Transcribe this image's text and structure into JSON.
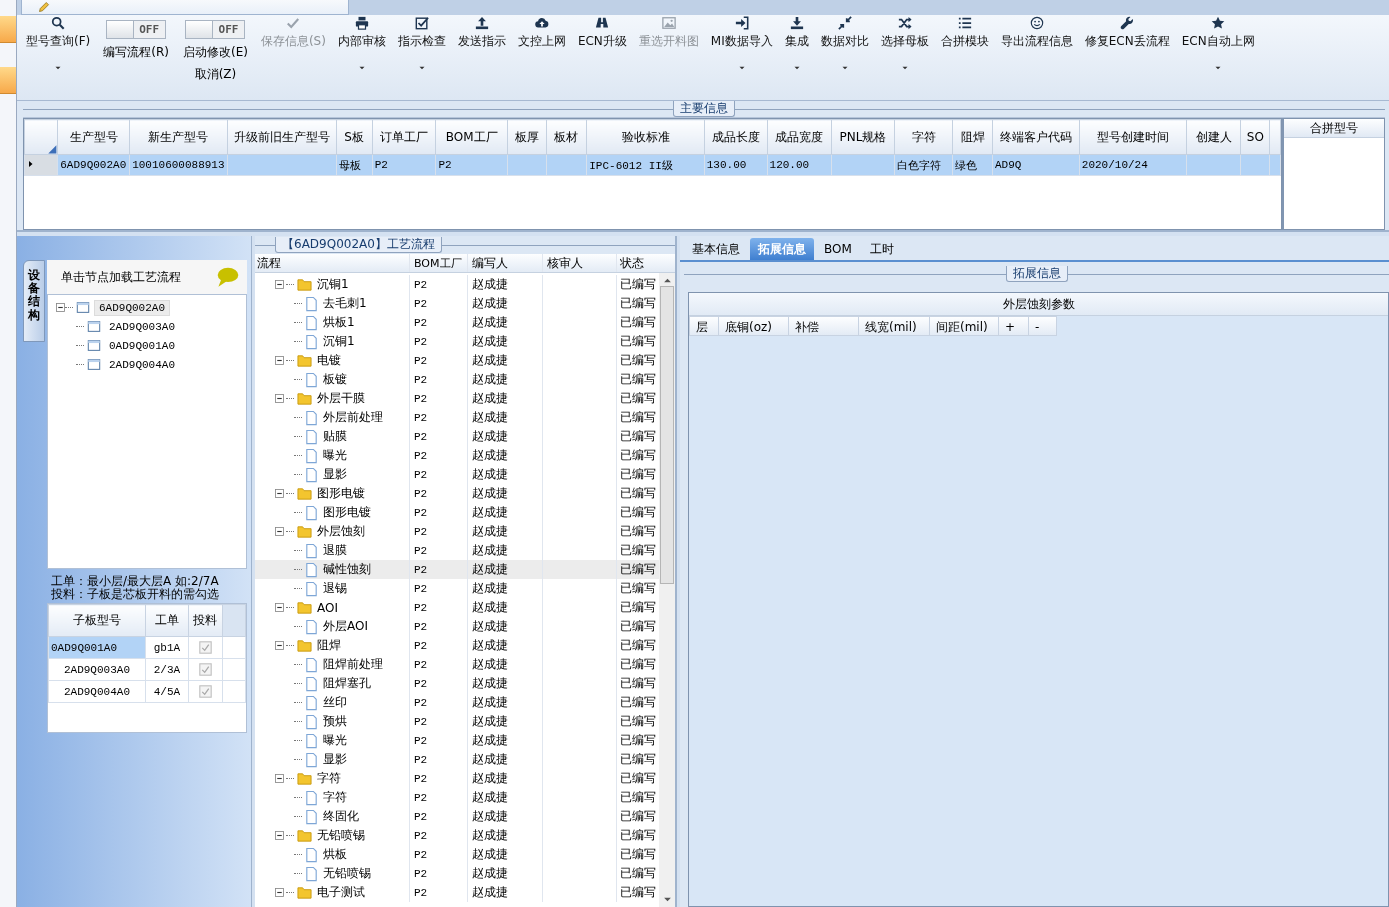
{
  "toolbar": [
    {
      "kind": "button",
      "label": "型号查询(F)",
      "disabled": false,
      "dropdown": true
    },
    {
      "kind": "toggle",
      "state_text": "OFF",
      "on": false,
      "label": "编写流程(R)"
    },
    {
      "kind": "toggle",
      "state_text": "OFF",
      "on": false,
      "label": "启动修改(E)",
      "label_2": "取消(Z)"
    },
    {
      "kind": "button",
      "label": "保存信息(S)",
      "disabled": true,
      "dropdown": false
    },
    {
      "kind": "button",
      "label": "内部审核",
      "disabled": false,
      "dropdown": true
    },
    {
      "kind": "button",
      "label": "指示检查",
      "disabled": false,
      "dropdown": true
    },
    {
      "kind": "button",
      "label": "发送指示",
      "disabled": false,
      "dropdown": false
    },
    {
      "kind": "button",
      "label": "文控上网",
      "disabled": false,
      "dropdown": false
    },
    {
      "kind": "button",
      "label": "ECN升级",
      "disabled": false,
      "dropdown": false
    },
    {
      "kind": "button",
      "label": "重选开料图",
      "disabled": true,
      "dropdown": false
    },
    {
      "kind": "button",
      "label": "MI数据导入",
      "disabled": false,
      "dropdown": true
    },
    {
      "kind": "button",
      "label": "集成",
      "disabled": false,
      "dropdown": true
    },
    {
      "kind": "button",
      "label": "数据对比",
      "disabled": false,
      "dropdown": true
    },
    {
      "kind": "button",
      "label": "选择母板",
      "disabled": false,
      "dropdown": true
    },
    {
      "kind": "button",
      "label": "合拼模块",
      "disabled": false,
      "dropdown": false
    },
    {
      "kind": "button",
      "label": "导出流程信息",
      "disabled": false,
      "dropdown": false
    },
    {
      "kind": "button",
      "label": "修复ECN丢流程",
      "disabled": false,
      "dropdown": false
    },
    {
      "kind": "button",
      "label": "ECN自动上网",
      "disabled": false,
      "dropdown": true
    }
  ],
  "main_info": {
    "legend": "主要信息",
    "columns": [
      "生产型号",
      "新生产型号",
      "升级前旧生产型号",
      "S板",
      "订单工厂",
      "BOM工厂",
      "板厚",
      "板材",
      "验收标准",
      "成品长度",
      "成品宽度",
      "PNL规格",
      "字符",
      "阻焊",
      "终端客户代码",
      "型号创建时间",
      "创建人",
      "SO"
    ],
    "rows": [
      {
        "selected": true,
        "cells": [
          "6AD9Q002A0",
          "10010600088913",
          "",
          "母板",
          "P2",
          "P2",
          "",
          "",
          "IPC-6012 II级",
          "130.00",
          "120.00",
          "",
          "白色字符",
          "绿色",
          "AD9Q",
          "2020/10/24",
          "",
          ""
        ]
      }
    ],
    "side_panel": {
      "title": "合拼型号"
    }
  },
  "board_panel": {
    "tab": "设备结构",
    "hint": "单击节点加载工艺流程",
    "nodes": [
      {
        "name": "6AD9Q002A0",
        "selected": true,
        "expanded": true,
        "children": [
          {
            "name": "2AD9Q003A0",
            "selected": false
          },
          {
            "name": "0AD9Q001A0",
            "selected": false
          },
          {
            "name": "2AD9Q004A0",
            "selected": false
          }
        ]
      }
    ],
    "notes": [
      "工单：最小层/最大层A 如:2/7A",
      "投料：子板是芯板开料的需勾选"
    ],
    "columns": [
      "子板型号",
      "工单",
      "投料"
    ],
    "rows": [
      {
        "selected": true,
        "cells": [
          "0AD9Q001A0",
          "gb1A"
        ],
        "checked": true
      },
      {
        "selected": false,
        "cells": [
          "2AD9Q003A0",
          "2/3A"
        ],
        "checked": true
      },
      {
        "selected": false,
        "cells": [
          "2AD9Q004A0",
          "4/5A"
        ],
        "checked": true
      }
    ]
  },
  "process": {
    "legend": "【6AD9Q002A0】工艺流程",
    "columns": [
      "流程",
      "BOM工厂",
      "编写人",
      "核审人",
      "状态"
    ],
    "nodes": [
      {
        "kind": "group",
        "name": "沉铜1",
        "factory": "P2",
        "writer": "赵成捷",
        "status": "已编写",
        "selected": false,
        "expanded": true,
        "children": [
          {
            "kind": "step",
            "name": "去毛刺1",
            "factory": "P2",
            "writer": "赵成捷",
            "status": "已编写",
            "selected": false
          },
          {
            "kind": "step",
            "name": "烘板1",
            "factory": "P2",
            "writer": "赵成捷",
            "status": "已编写",
            "selected": false
          },
          {
            "kind": "step",
            "name": "沉铜1",
            "factory": "P2",
            "writer": "赵成捷",
            "status": "已编写",
            "selected": false
          }
        ]
      },
      {
        "kind": "group",
        "name": "电镀",
        "factory": "P2",
        "writer": "赵成捷",
        "status": "已编写",
        "selected": false,
        "expanded": true,
        "children": [
          {
            "kind": "step",
            "name": "板镀",
            "factory": "P2",
            "writer": "赵成捷",
            "status": "已编写",
            "selected": false
          }
        ]
      },
      {
        "kind": "group",
        "name": "外层干膜",
        "factory": "P2",
        "writer": "赵成捷",
        "status": "已编写",
        "selected": false,
        "expanded": true,
        "children": [
          {
            "kind": "step",
            "name": "外层前处理",
            "factory": "P2",
            "writer": "赵成捷",
            "status": "已编写",
            "selected": false
          },
          {
            "kind": "step",
            "name": "贴膜",
            "factory": "P2",
            "writer": "赵成捷",
            "status": "已编写",
            "selected": false
          },
          {
            "kind": "step",
            "name": "曝光",
            "factory": "P2",
            "writer": "赵成捷",
            "status": "已编写",
            "selected": false
          },
          {
            "kind": "step",
            "name": "显影",
            "factory": "P2",
            "writer": "赵成捷",
            "status": "已编写",
            "selected": false
          }
        ]
      },
      {
        "kind": "group",
        "name": "图形电镀",
        "factory": "P2",
        "writer": "赵成捷",
        "status": "已编写",
        "selected": false,
        "expanded": true,
        "children": [
          {
            "kind": "step",
            "name": "图形电镀",
            "factory": "P2",
            "writer": "赵成捷",
            "status": "已编写",
            "selected": false
          }
        ]
      },
      {
        "kind": "group",
        "name": "外层蚀刻",
        "factory": "P2",
        "writer": "赵成捷",
        "status": "已编写",
        "selected": false,
        "expanded": true,
        "children": [
          {
            "kind": "step",
            "name": "退膜",
            "factory": "P2",
            "writer": "赵成捷",
            "status": "已编写",
            "selected": false
          },
          {
            "kind": "step",
            "name": "碱性蚀刻",
            "factory": "P2",
            "writer": "赵成捷",
            "status": "已编写",
            "selected": true
          },
          {
            "kind": "step",
            "name": "退锡",
            "factory": "P2",
            "writer": "赵成捷",
            "status": "已编写",
            "selected": false
          }
        ]
      },
      {
        "kind": "group",
        "name": "AOI",
        "factory": "P2",
        "writer": "赵成捷",
        "status": "已编写",
        "selected": false,
        "expanded": true,
        "children": [
          {
            "kind": "step",
            "name": "外层AOI",
            "factory": "P2",
            "writer": "赵成捷",
            "status": "已编写",
            "selected": false
          }
        ]
      },
      {
        "kind": "group",
        "name": "阻焊",
        "factory": "P2",
        "writer": "赵成捷",
        "status": "已编写",
        "selected": false,
        "expanded": true,
        "children": [
          {
            "kind": "step",
            "name": "阻焊前处理",
            "factory": "P2",
            "writer": "赵成捷",
            "status": "已编写",
            "selected": false
          },
          {
            "kind": "step",
            "name": "阻焊塞孔",
            "factory": "P2",
            "writer": "赵成捷",
            "status": "已编写",
            "selected": false
          },
          {
            "kind": "step",
            "name": "丝印",
            "factory": "P2",
            "writer": "赵成捷",
            "status": "已编写",
            "selected": false
          },
          {
            "kind": "step",
            "name": "预烘",
            "factory": "P2",
            "writer": "赵成捷",
            "status": "已编写",
            "selected": false
          },
          {
            "kind": "step",
            "name": "曝光",
            "factory": "P2",
            "writer": "赵成捷",
            "status": "已编写",
            "selected": false
          },
          {
            "kind": "step",
            "name": "显影",
            "factory": "P2",
            "writer": "赵成捷",
            "status": "已编写",
            "selected": false
          }
        ]
      },
      {
        "kind": "group",
        "name": "字符",
        "factory": "P2",
        "writer": "赵成捷",
        "status": "已编写",
        "selected": false,
        "expanded": true,
        "children": [
          {
            "kind": "step",
            "name": "字符",
            "factory": "P2",
            "writer": "赵成捷",
            "status": "已编写",
            "selected": false
          },
          {
            "kind": "step",
            "name": "终固化",
            "factory": "P2",
            "writer": "赵成捷",
            "status": "已编写",
            "selected": false
          }
        ]
      },
      {
        "kind": "group",
        "name": "无铅喷锡",
        "factory": "P2",
        "writer": "赵成捷",
        "status": "已编写",
        "selected": false,
        "expanded": true,
        "children": [
          {
            "kind": "step",
            "name": "烘板",
            "factory": "P2",
            "writer": "赵成捷",
            "status": "已编写",
            "selected": false
          },
          {
            "kind": "step",
            "name": "无铅喷锡",
            "factory": "P2",
            "writer": "赵成捷",
            "status": "已编写",
            "selected": false
          }
        ]
      },
      {
        "kind": "group",
        "name": "电子测试",
        "factory": "P2",
        "writer": "赵成捷",
        "status": "已编写",
        "selected": false,
        "expanded": true
      }
    ]
  },
  "detail": {
    "tabs": [
      {
        "label": "基本信息",
        "selected": false
      },
      {
        "label": "拓展信息",
        "selected": true
      },
      {
        "label": "BOM",
        "selected": false
      },
      {
        "label": "工时",
        "selected": false
      }
    ],
    "legend": "拓展信息",
    "grid_title": "外层蚀刻参数",
    "columns": [
      "层",
      "底铜(oz)",
      "补偿",
      "线宽(mil)",
      "间距(mil)",
      "+",
      "-"
    ]
  }
}
